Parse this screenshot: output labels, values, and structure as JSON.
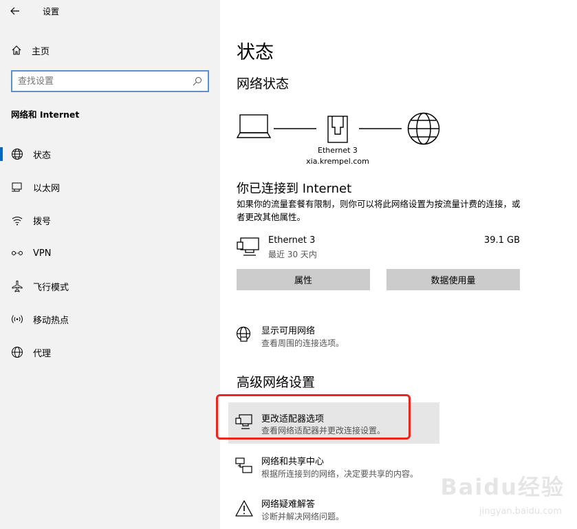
{
  "titlebar": {
    "title": "设置"
  },
  "sidebar": {
    "home_label": "主页",
    "search_placeholder": "查找设置",
    "section_title": "网络和 Internet",
    "items": [
      {
        "label": "状态",
        "icon": "status-icon",
        "active": true
      },
      {
        "label": "以太网",
        "icon": "ethernet-icon"
      },
      {
        "label": "拨号",
        "icon": "dialup-icon"
      },
      {
        "label": "VPN",
        "icon": "vpn-icon"
      },
      {
        "label": "飞行模式",
        "icon": "airplane-icon"
      },
      {
        "label": "移动热点",
        "icon": "hotspot-icon"
      },
      {
        "label": "代理",
        "icon": "globe-icon"
      }
    ]
  },
  "main": {
    "page_title": "状态",
    "network_status_heading": "网络状态",
    "diagram": {
      "adapter_name": "Ethernet 3",
      "domain": "xia.krempel.com"
    },
    "connected_title": "你已连接到 Internet",
    "connected_desc": "如果你的流量套餐有限制，则你可以将此网络设置为按流量计费的连接，或者更改其他属性。",
    "ethernet": {
      "name": "Ethernet 3",
      "period": "最近 30 天内",
      "usage": "39.1 GB"
    },
    "buttons": {
      "properties": "属性",
      "data_usage": "数据使用量"
    },
    "show_networks": {
      "title": "显示可用网络",
      "subtitle": "查看周围的连接选项。"
    },
    "advanced_heading": "高级网络设置",
    "advanced": [
      {
        "title": "更改适配器选项",
        "subtitle": "查看网络适配器并更改连接设置。"
      },
      {
        "title": "网络和共享中心",
        "subtitle": "根据所连接到的网络，决定要共享的内容。"
      },
      {
        "title": "网络疑难解答",
        "subtitle": "诊断并解决网络问题。"
      }
    ]
  },
  "watermark": {
    "logo": "Baidu经验",
    "url": "jingyan.baidu.com"
  },
  "colors": {
    "accent": "#0067c0",
    "search_border": "#5b91cc",
    "highlight_box": "#e8261f"
  }
}
